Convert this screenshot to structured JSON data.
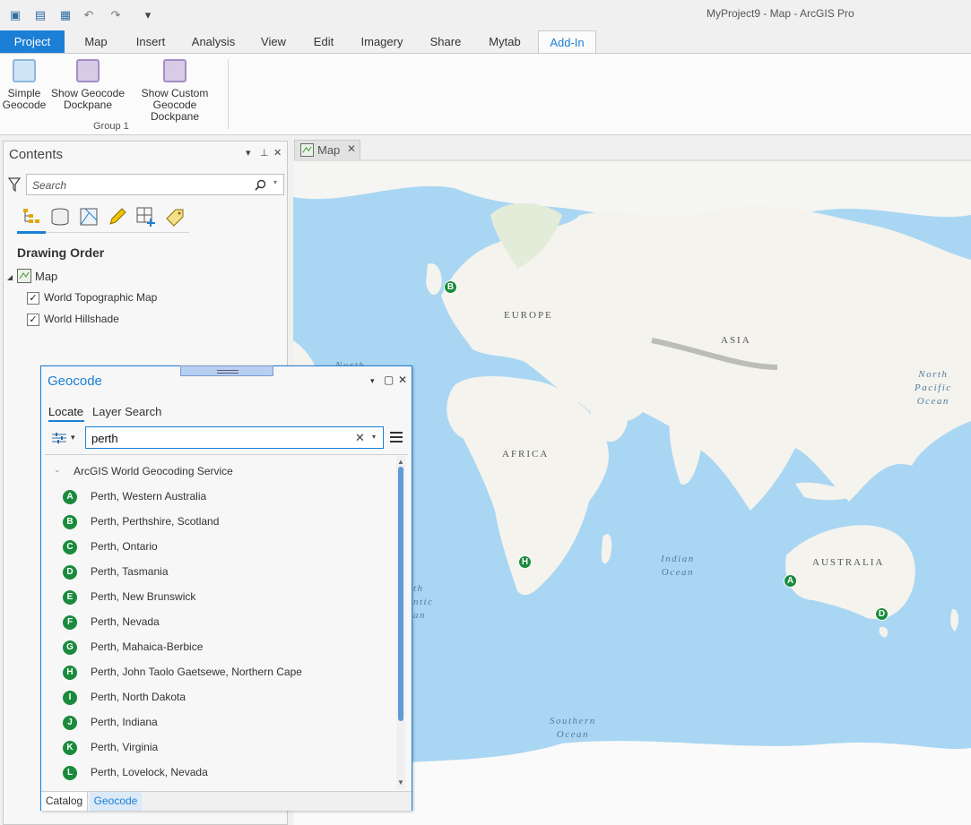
{
  "window": {
    "title": "MyProject9 - Map - ArcGIS Pro"
  },
  "quick_access": {
    "icons": [
      "new-project-icon",
      "open-project-icon",
      "save-project-icon",
      "undo-icon",
      "redo-icon",
      "customize-icon"
    ],
    "glyphs": [
      "▣",
      "▤",
      "▦",
      "↶",
      "↷",
      "▾"
    ]
  },
  "ribbon": {
    "tabs": [
      "Project",
      "Map",
      "Insert",
      "Analysis",
      "View",
      "Edit",
      "Imagery",
      "Share",
      "Mytab",
      "Add-In"
    ],
    "active_tab": "Add-In",
    "buttons": [
      {
        "label": "Simple\nGeocode",
        "line1": "Simple",
        "line2": "Geocode"
      },
      {
        "label": "Show Geocode Dockpane",
        "line1": "Show Geocode",
        "line2": "Dockpane"
      },
      {
        "label": "Show Custom Geocode Dockpane",
        "line1": "Show Custom",
        "line2": "Geocode Dockpane"
      }
    ],
    "group_label": "Group 1"
  },
  "contents": {
    "title": "Contents",
    "search_placeholder": "Search",
    "section": "Drawing Order",
    "map_node": "Map",
    "layers": [
      {
        "name": "World Topographic Map",
        "checked": true
      },
      {
        "name": "World Hillshade",
        "checked": true
      }
    ],
    "tools": [
      "list-by-drawing-order-icon",
      "list-by-source-icon",
      "list-by-selection-icon",
      "list-by-editing-icon",
      "list-by-snapping-icon",
      "list-by-labeling-icon"
    ]
  },
  "map": {
    "tab_label": "Map",
    "labels": {
      "europe": "EUROPE",
      "asia": "ASIA",
      "africa": "AFRICA",
      "australia": "AUSTRALIA"
    },
    "oceans": {
      "north_pacific": [
        "North",
        "Pacific",
        "Ocean"
      ],
      "indian": [
        "Indian",
        "Ocean"
      ],
      "southern": [
        "Southern",
        "Ocean"
      ],
      "atlantic_fragments": [
        "North",
        "th",
        "ntic",
        "an"
      ]
    },
    "pins": [
      "A",
      "B",
      "D",
      "H"
    ]
  },
  "geocode": {
    "title": "Geocode",
    "tabs": [
      "Locate",
      "Layer Search"
    ],
    "search_value": "perth",
    "provider": "ArcGIS World Geocoding Service",
    "results": [
      {
        "letter": "A",
        "label": "Perth, Western Australia"
      },
      {
        "letter": "B",
        "label": "Perth, Perthshire, Scotland"
      },
      {
        "letter": "C",
        "label": "Perth, Ontario"
      },
      {
        "letter": "D",
        "label": "Perth, Tasmania"
      },
      {
        "letter": "E",
        "label": "Perth, New Brunswick"
      },
      {
        "letter": "F",
        "label": "Perth, Nevada"
      },
      {
        "letter": "G",
        "label": "Perth, Mahaica-Berbice"
      },
      {
        "letter": "H",
        "label": "Perth, John Taolo Gaetsewe, Northern Cape"
      },
      {
        "letter": "I",
        "label": "Perth, North Dakota"
      },
      {
        "letter": "J",
        "label": "Perth, Indiana"
      },
      {
        "letter": "K",
        "label": "Perth, Virginia"
      },
      {
        "letter": "L",
        "label": "Perth, Lovelock, Nevada"
      }
    ],
    "bottom_tabs": [
      "Catalog",
      "Geocode"
    ]
  },
  "colors": {
    "accent": "#1c7fd6",
    "pin": "#1a8b3c",
    "ocean": "#a9d6f2",
    "land": "#f4f3ee"
  }
}
